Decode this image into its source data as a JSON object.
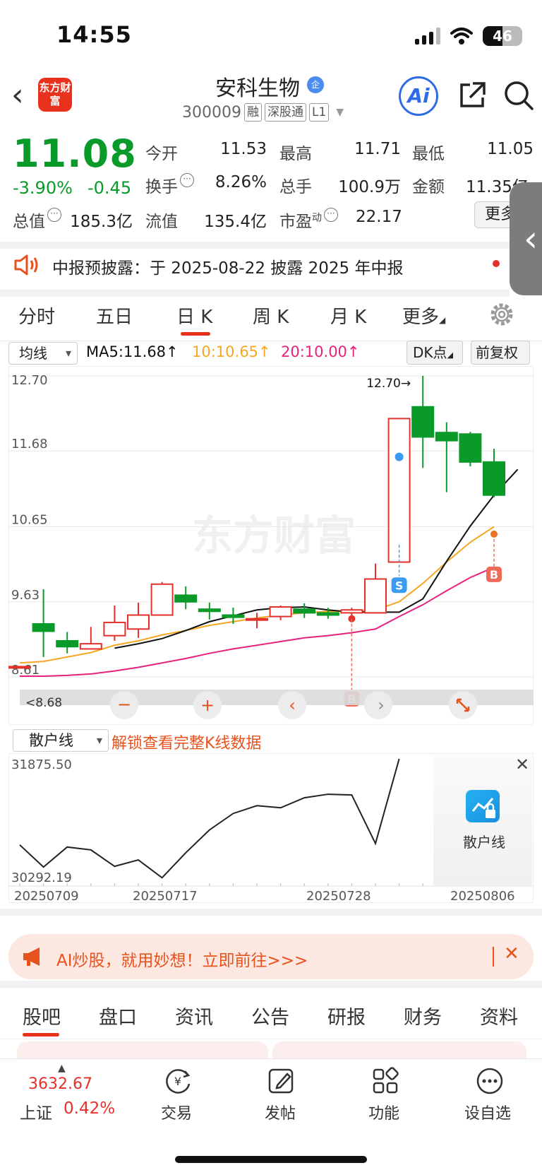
{
  "status": {
    "time": "14:55",
    "battery": "46"
  },
  "header": {
    "logo": "东方财富",
    "name": "安科生物",
    "badge": "企",
    "code": "300009",
    "tags": [
      "融",
      "深股通",
      "L1"
    ],
    "ai_label": "Ai"
  },
  "quote": {
    "price": "11.08",
    "change_pct": "-3.90%",
    "change_amt": "-0.45",
    "fields": {
      "open_label": "今开",
      "open": "11.53",
      "high_label": "最高",
      "high": "11.71",
      "low_label": "最低",
      "low": "11.05",
      "turnover_label": "换手",
      "turnover": "8.26%",
      "volume_label": "总手",
      "volume": "100.9万",
      "amount_label": "金额",
      "amount": "11.35亿",
      "mktcap_label": "总值",
      "mktcap": "185.3亿",
      "float_label": "流值",
      "float": "135.4亿",
      "pe_label": "市盈",
      "pe_sup": "动",
      "pe": "22.17"
    },
    "more": "更多"
  },
  "notice": {
    "text": "中报预披露：于 2025-08-22 披露 2025 年中报"
  },
  "period_tabs": [
    "分时",
    "五日",
    "日 K",
    "周 K",
    "月 K",
    "更多"
  ],
  "active_period": "日 K",
  "ma": {
    "select": "均线",
    "ma5": "MA5:11.68↑",
    "ma10": "10:10.65↑",
    "ma20": "20:10.00↑",
    "dk": "DK点",
    "fq": "前复权",
    "colors": {
      "ma5": "#111111",
      "ma10": "#f5a623",
      "ma20": "#e8207e",
      "up": "#e4312b",
      "down": "#0a9a2a"
    }
  },
  "chart_data": [
    {
      "type": "candlestick",
      "y_ticks": [
        "12.70",
        "11.68",
        "10.65",
        "9.63",
        "8.61"
      ],
      "ylim": [
        8.61,
        12.7
      ],
      "max_marker": "12.70→",
      "min_marker": "8.68",
      "watermark": "东方财富",
      "candles": [
        {
          "o": 8.75,
          "c": 8.75,
          "h": 8.75,
          "l": 8.75
        },
        {
          "o": 9.33,
          "c": 9.23,
          "h": 9.8,
          "l": 8.88
        },
        {
          "o": 9.1,
          "c": 9.02,
          "h": 9.22,
          "l": 8.93
        },
        {
          "o": 8.99,
          "c": 9.06,
          "h": 9.29,
          "l": 8.98
        },
        {
          "o": 9.17,
          "c": 9.35,
          "h": 9.58,
          "l": 9.1
        },
        {
          "o": 9.26,
          "c": 9.45,
          "h": 9.62,
          "l": 9.14
        },
        {
          "o": 9.45,
          "c": 9.87,
          "h": 9.9,
          "l": 9.45
        },
        {
          "o": 9.72,
          "c": 9.63,
          "h": 9.84,
          "l": 9.53
        },
        {
          "o": 9.53,
          "c": 9.5,
          "h": 9.62,
          "l": 9.39
        },
        {
          "o": 9.45,
          "c": 9.42,
          "h": 9.55,
          "l": 9.33
        },
        {
          "o": 9.39,
          "c": 9.4,
          "h": 9.48,
          "l": 9.27
        },
        {
          "o": 9.43,
          "c": 9.56,
          "h": 9.58,
          "l": 9.38
        },
        {
          "o": 9.53,
          "c": 9.48,
          "h": 9.61,
          "l": 9.41
        },
        {
          "o": 9.48,
          "c": 9.45,
          "h": 9.55,
          "l": 9.4
        },
        {
          "o": 9.48,
          "c": 9.52,
          "h": 9.55,
          "l": 9.37
        },
        {
          "o": 9.48,
          "c": 9.94,
          "h": 10.15,
          "l": 9.48
        },
        {
          "o": 10.17,
          "c": 12.12,
          "h": 12.12,
          "l": 10.17
        },
        {
          "o": 12.28,
          "c": 11.87,
          "h": 12.7,
          "l": 11.45
        },
        {
          "o": 11.93,
          "c": 11.82,
          "h": 12.07,
          "l": 11.12
        },
        {
          "o": 11.91,
          "c": 11.53,
          "h": 11.94,
          "l": 11.47
        },
        {
          "o": 11.53,
          "c": 11.08,
          "h": 11.71,
          "l": 11.05
        }
      ],
      "ma5": [
        null,
        null,
        null,
        null,
        9.0,
        9.06,
        9.13,
        9.24,
        9.36,
        9.44,
        9.52,
        9.55,
        9.56,
        9.52,
        9.49,
        9.49,
        9.49,
        9.67,
        10.18,
        10.66,
        11.08,
        11.43
      ],
      "ma10": [
        8.8,
        8.82,
        8.88,
        8.94,
        9.04,
        9.1,
        9.18,
        9.24,
        9.31,
        9.36,
        9.41,
        9.45,
        9.48,
        9.5,
        9.5,
        9.52,
        9.63,
        9.88,
        10.17,
        10.44,
        10.65
      ],
      "ma20": [
        8.62,
        8.62,
        8.63,
        8.65,
        8.69,
        8.74,
        8.8,
        8.86,
        8.93,
        8.99,
        9.04,
        9.09,
        9.14,
        9.17,
        9.21,
        9.26,
        9.43,
        9.59,
        9.78,
        9.96,
        10.1
      ],
      "signals": [
        {
          "index": 14,
          "type": "B",
          "value": 9.4
        },
        {
          "index": 16,
          "type": "S",
          "value": 9.98
        },
        {
          "index": 16,
          "type": "dot",
          "value": 11.6
        },
        {
          "index": 20,
          "type": "B",
          "value": 10.55
        }
      ]
    },
    {
      "type": "line",
      "name": "散户线",
      "y_ticks": [
        "31875.50",
        "30292.19"
      ],
      "ylim": [
        30292.19,
        31875.5
      ],
      "x_ticks": [
        "20250709",
        "20250717",
        "20250728",
        "20250806"
      ],
      "values": [
        30670,
        30360,
        30640,
        30600,
        30370,
        30460,
        30210,
        30560,
        30880,
        31110,
        31220,
        31190,
        31330,
        31380,
        31370,
        30690,
        31875
      ]
    }
  ],
  "investor": {
    "select": "散户线",
    "unlock": "解锁查看完整K线数据",
    "panel_label": "散户线"
  },
  "ad": {
    "text": "AI炒股，就用妙想！立即前往>>>"
  },
  "content_tabs": [
    "股吧",
    "盘口",
    "资讯",
    "公告",
    "研报",
    "财务",
    "资料"
  ],
  "bottom_nav": {
    "index_value": "3632.67",
    "index_name": "上证",
    "index_pct": "0.42%",
    "items": [
      "交易",
      "发帖",
      "功能",
      "设自选"
    ]
  }
}
